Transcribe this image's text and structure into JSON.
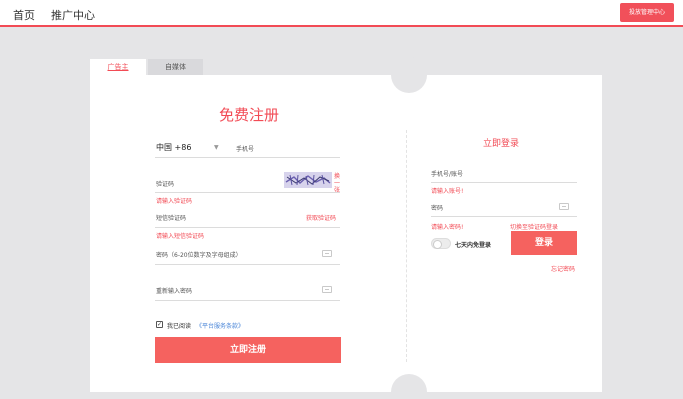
{
  "topbar": {
    "nav": [
      "首页",
      "推广中心"
    ],
    "button_label": "投放管理中心"
  },
  "tabs": {
    "active": "广告主",
    "other": "自媒体"
  },
  "register": {
    "title": "免费注册",
    "country_code": "中国 +86",
    "phone_placeholder": "手机号",
    "captcha_label": "验证码",
    "captcha_refresh": "换一张",
    "captcha_error": "请输入验证码",
    "sms_label": "短信验证码",
    "get_code": "获取验证码",
    "sms_error": "请输入短信验证码",
    "password_placeholder": "密码（6-20位数字及字母组成）",
    "confirm_placeholder": "重新输入密码",
    "agree_check": "✓",
    "agree_text": "我已阅读",
    "agree_link": "《平台服务条款》",
    "submit": "立即注册"
  },
  "login": {
    "title": "立即登录",
    "account_placeholder": "手机号/账号",
    "account_error": "请输入账号!",
    "password_placeholder": "密码",
    "password_error": "请输入密码!",
    "switch_sms": "切换至验证码登录",
    "remember": "七天内免登录",
    "submit": "登录",
    "forgot": "忘记密码"
  },
  "colors": {
    "accent": "#f24b55",
    "button": "#f5625f",
    "link": "#4a86d8"
  }
}
